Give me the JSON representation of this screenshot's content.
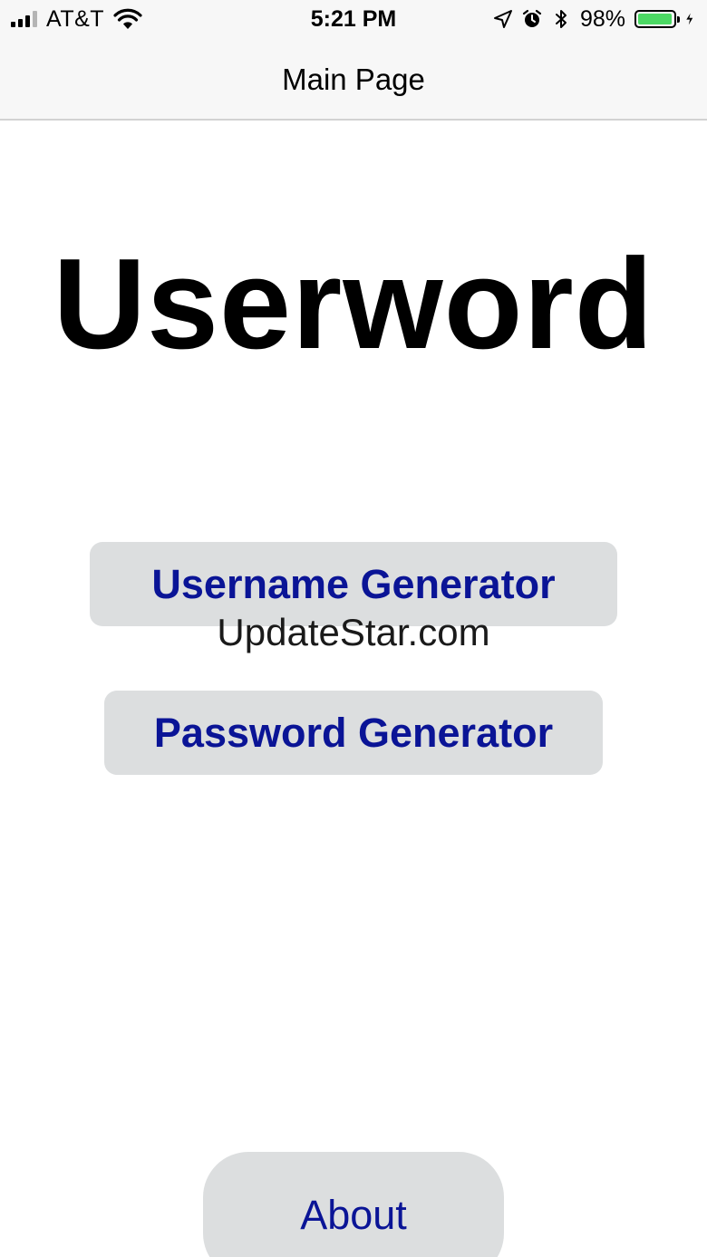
{
  "status_bar": {
    "carrier": "AT&T",
    "time": "5:21 PM",
    "battery_percent": "98%",
    "battery_level": 0.98,
    "battery_color": "#4cd964",
    "icons": [
      "signal-icon",
      "wifi-icon",
      "location-icon",
      "alarm-icon",
      "bluetooth-icon",
      "battery-icon",
      "charging-icon"
    ]
  },
  "nav": {
    "title": "Main Page"
  },
  "main": {
    "app_title": "Userword",
    "username_button": "Username Generator",
    "password_button": "Password Generator",
    "about_button": "About"
  },
  "watermark": "UpdateStar.com",
  "colors": {
    "button_text": "#0a1496",
    "button_bg": "#dcdedf"
  }
}
